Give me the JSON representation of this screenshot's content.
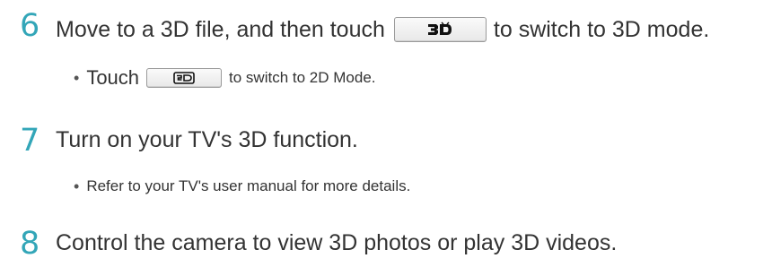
{
  "steps": [
    {
      "number": "6",
      "text_before": "Move to a 3D file, and then touch",
      "button_icon": "3d-mode-icon",
      "text_after": "to switch to 3D mode.",
      "sub": {
        "bullet": "•",
        "text_before": "Touch",
        "button_icon": "2d-mode-icon",
        "text_after": "to switch to 2D Mode."
      }
    },
    {
      "number": "7",
      "text": "Turn on your TV's 3D function.",
      "sub": {
        "bullet": "•",
        "text": "Refer to your TV's user manual for more details."
      }
    },
    {
      "number": "8",
      "text": "Control the camera to view 3D photos or play 3D videos."
    }
  ],
  "colors": {
    "step_number": "#33a6b8",
    "body_text": "#333333"
  }
}
